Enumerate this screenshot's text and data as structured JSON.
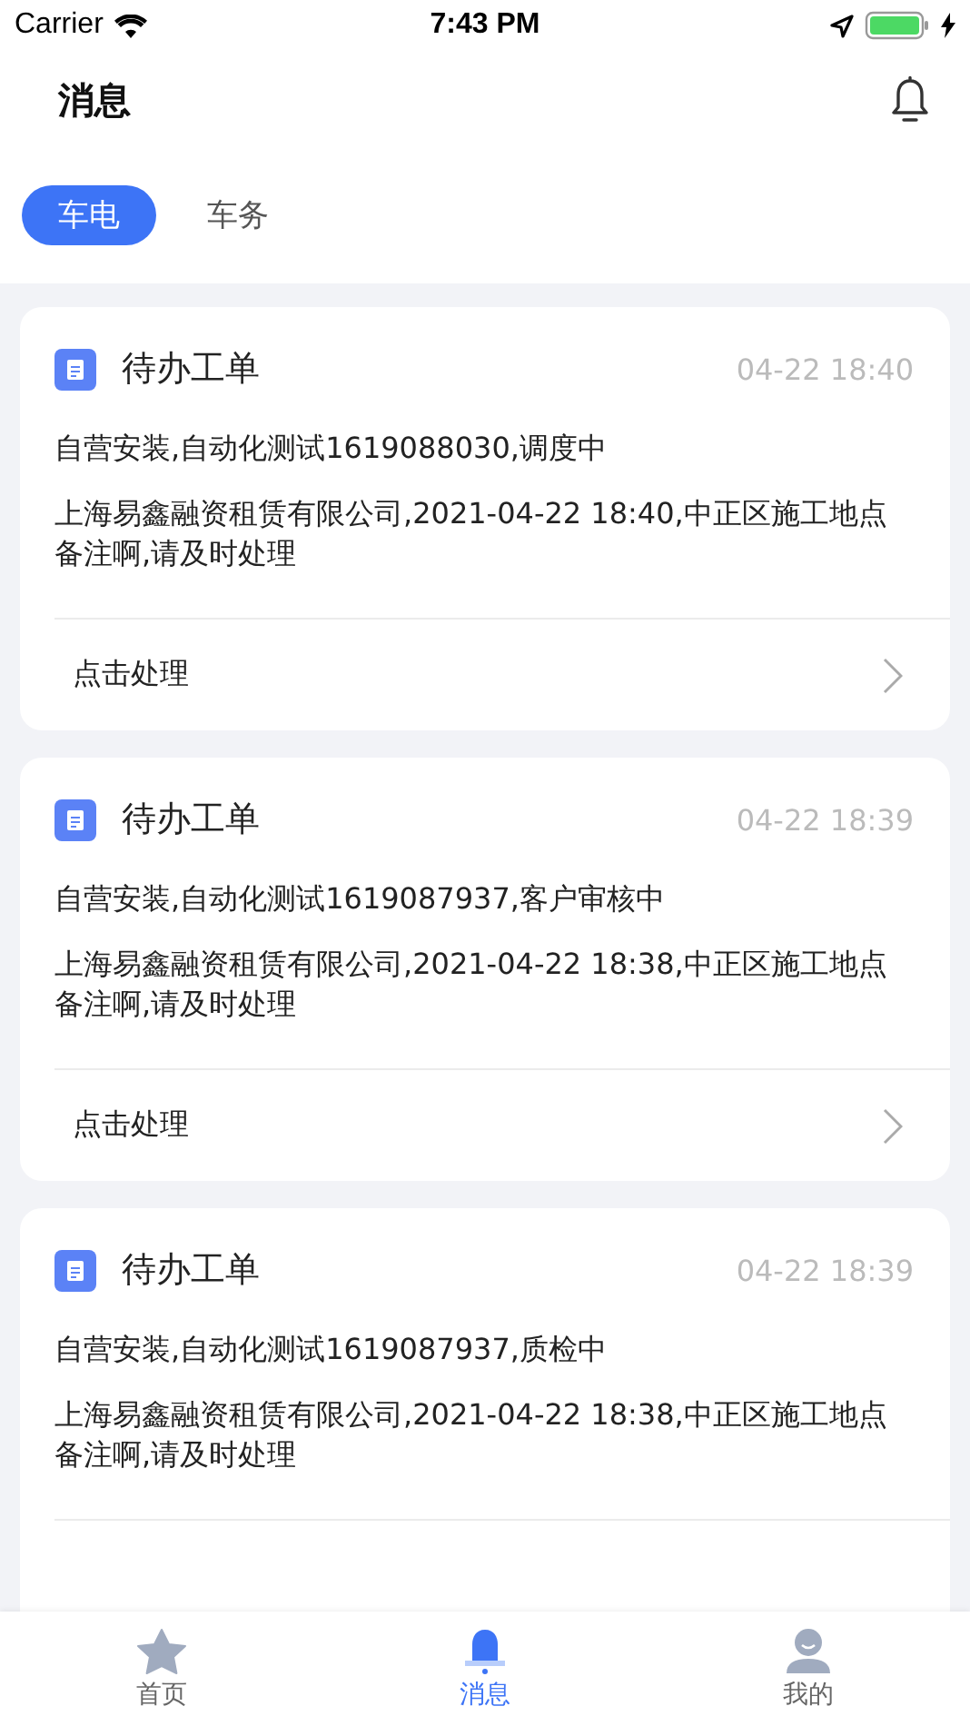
{
  "status_bar": {
    "carrier": "Carrier",
    "time": "7:43 PM"
  },
  "header": {
    "title": "消息"
  },
  "tabs": [
    {
      "label": "车电",
      "selected": true
    },
    {
      "label": "车务",
      "selected": false
    }
  ],
  "cards": [
    {
      "title": "待办工单",
      "time": "04-22 18:40",
      "summary": "自营安装,自动化测试1619088030,调度中",
      "detail": "上海易鑫融资租赁有限公司,2021-04-22 18:40,中正区施工地点备注啊,请及时处理",
      "action": "点击处理"
    },
    {
      "title": "待办工单",
      "time": "04-22 18:39",
      "summary": "自营安装,自动化测试1619087937,客户审核中",
      "detail": "上海易鑫融资租赁有限公司,2021-04-22 18:38,中正区施工地点备注啊,请及时处理",
      "action": "点击处理"
    },
    {
      "title": "待办工单",
      "time": "04-22 18:39",
      "summary": "自营安装,自动化测试1619087937,质检中",
      "detail": "上海易鑫融资租赁有限公司,2021-04-22 18:38,中正区施工地点备注啊,请及时处理"
    }
  ],
  "tab_bar": [
    {
      "label": "首页",
      "kind": "home",
      "selected": false
    },
    {
      "label": "消息",
      "kind": "messages",
      "selected": true
    },
    {
      "label": "我的",
      "kind": "profile",
      "selected": false
    }
  ]
}
